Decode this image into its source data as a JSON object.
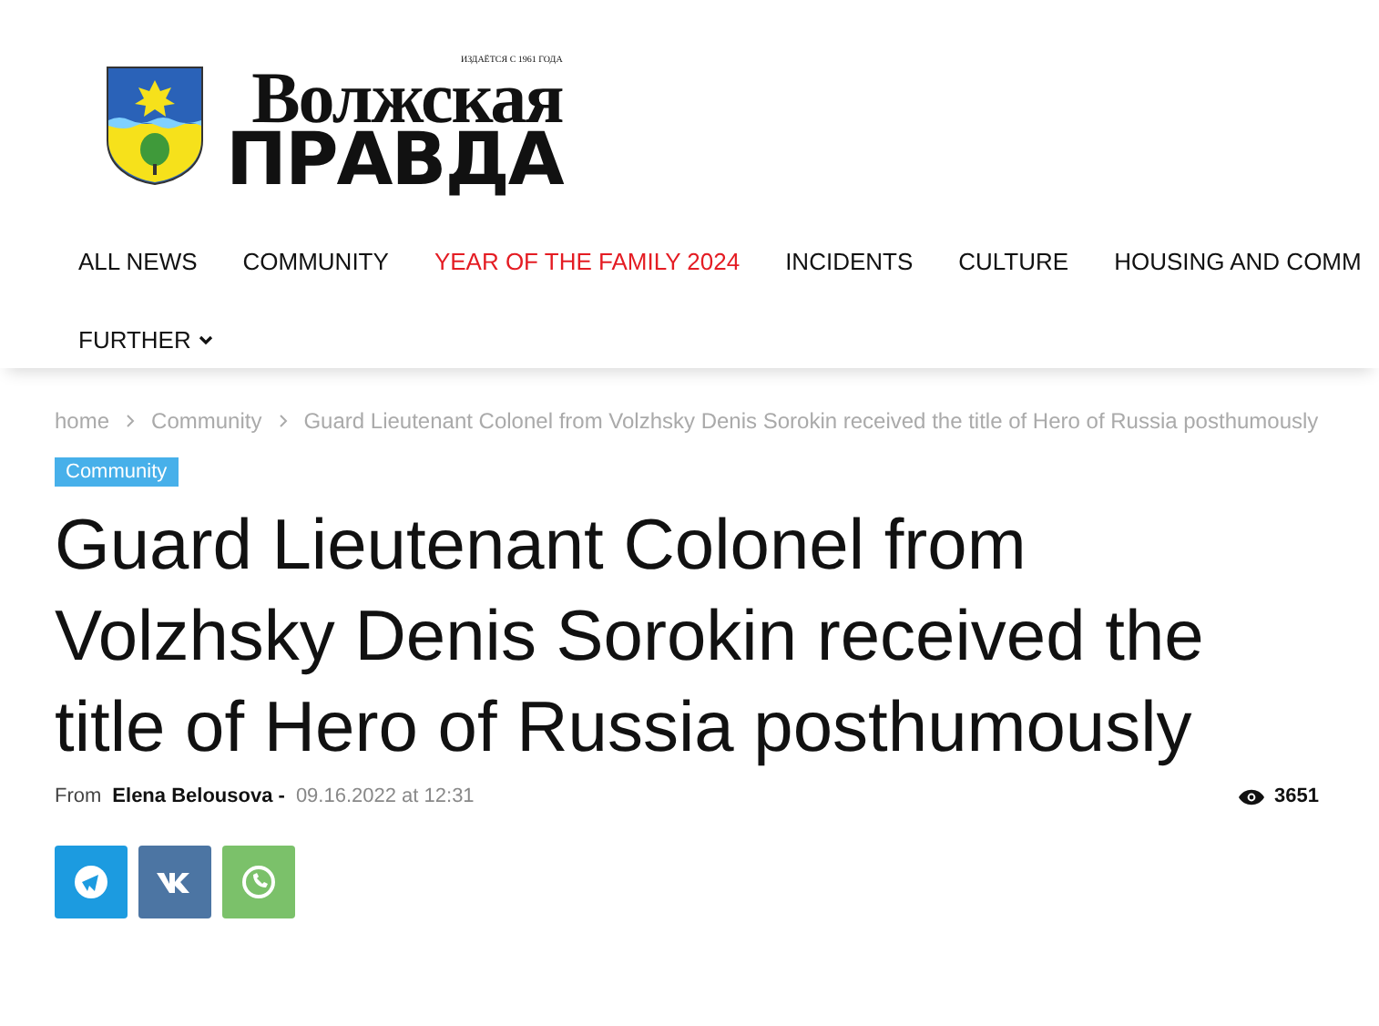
{
  "logo": {
    "tagline": "ИЗДАЁТСЯ С 1961 ГОДА",
    "line_1": "Волжская",
    "line_2": "ПРАВДА"
  },
  "nav": [
    {
      "label": "ALL NEWS",
      "highlighted": false
    },
    {
      "label": "COMMUNITY",
      "highlighted": false
    },
    {
      "label": "YEAR OF THE FAMILY 2024",
      "highlighted": true
    },
    {
      "label": "INCIDENTS",
      "highlighted": false
    },
    {
      "label": "CULTURE",
      "highlighted": false
    },
    {
      "label": "HOUSING AND COMM",
      "highlighted": false
    }
  ],
  "nav_more": "FURTHER",
  "breadcrumbs": [
    "home",
    "Community",
    "Guard Lieutenant Colonel from Volzhsky Denis Sorokin received the title of Hero of Russia posthumously"
  ],
  "category": "Community",
  "title": "Guard Lieutenant Colonel from Volzhsky Denis Sorokin received the title of Hero of Russia posthumously",
  "meta": {
    "by": "From",
    "author": "Elena Belousova -",
    "date": "09.16.2022 at 12:31",
    "views": "3651"
  },
  "share": [
    {
      "kind": "telegram",
      "color": "#1c9be0"
    },
    {
      "kind": "vk",
      "color": "#4c75a3"
    },
    {
      "kind": "whatsapp",
      "color": "#7bc16a"
    }
  ]
}
